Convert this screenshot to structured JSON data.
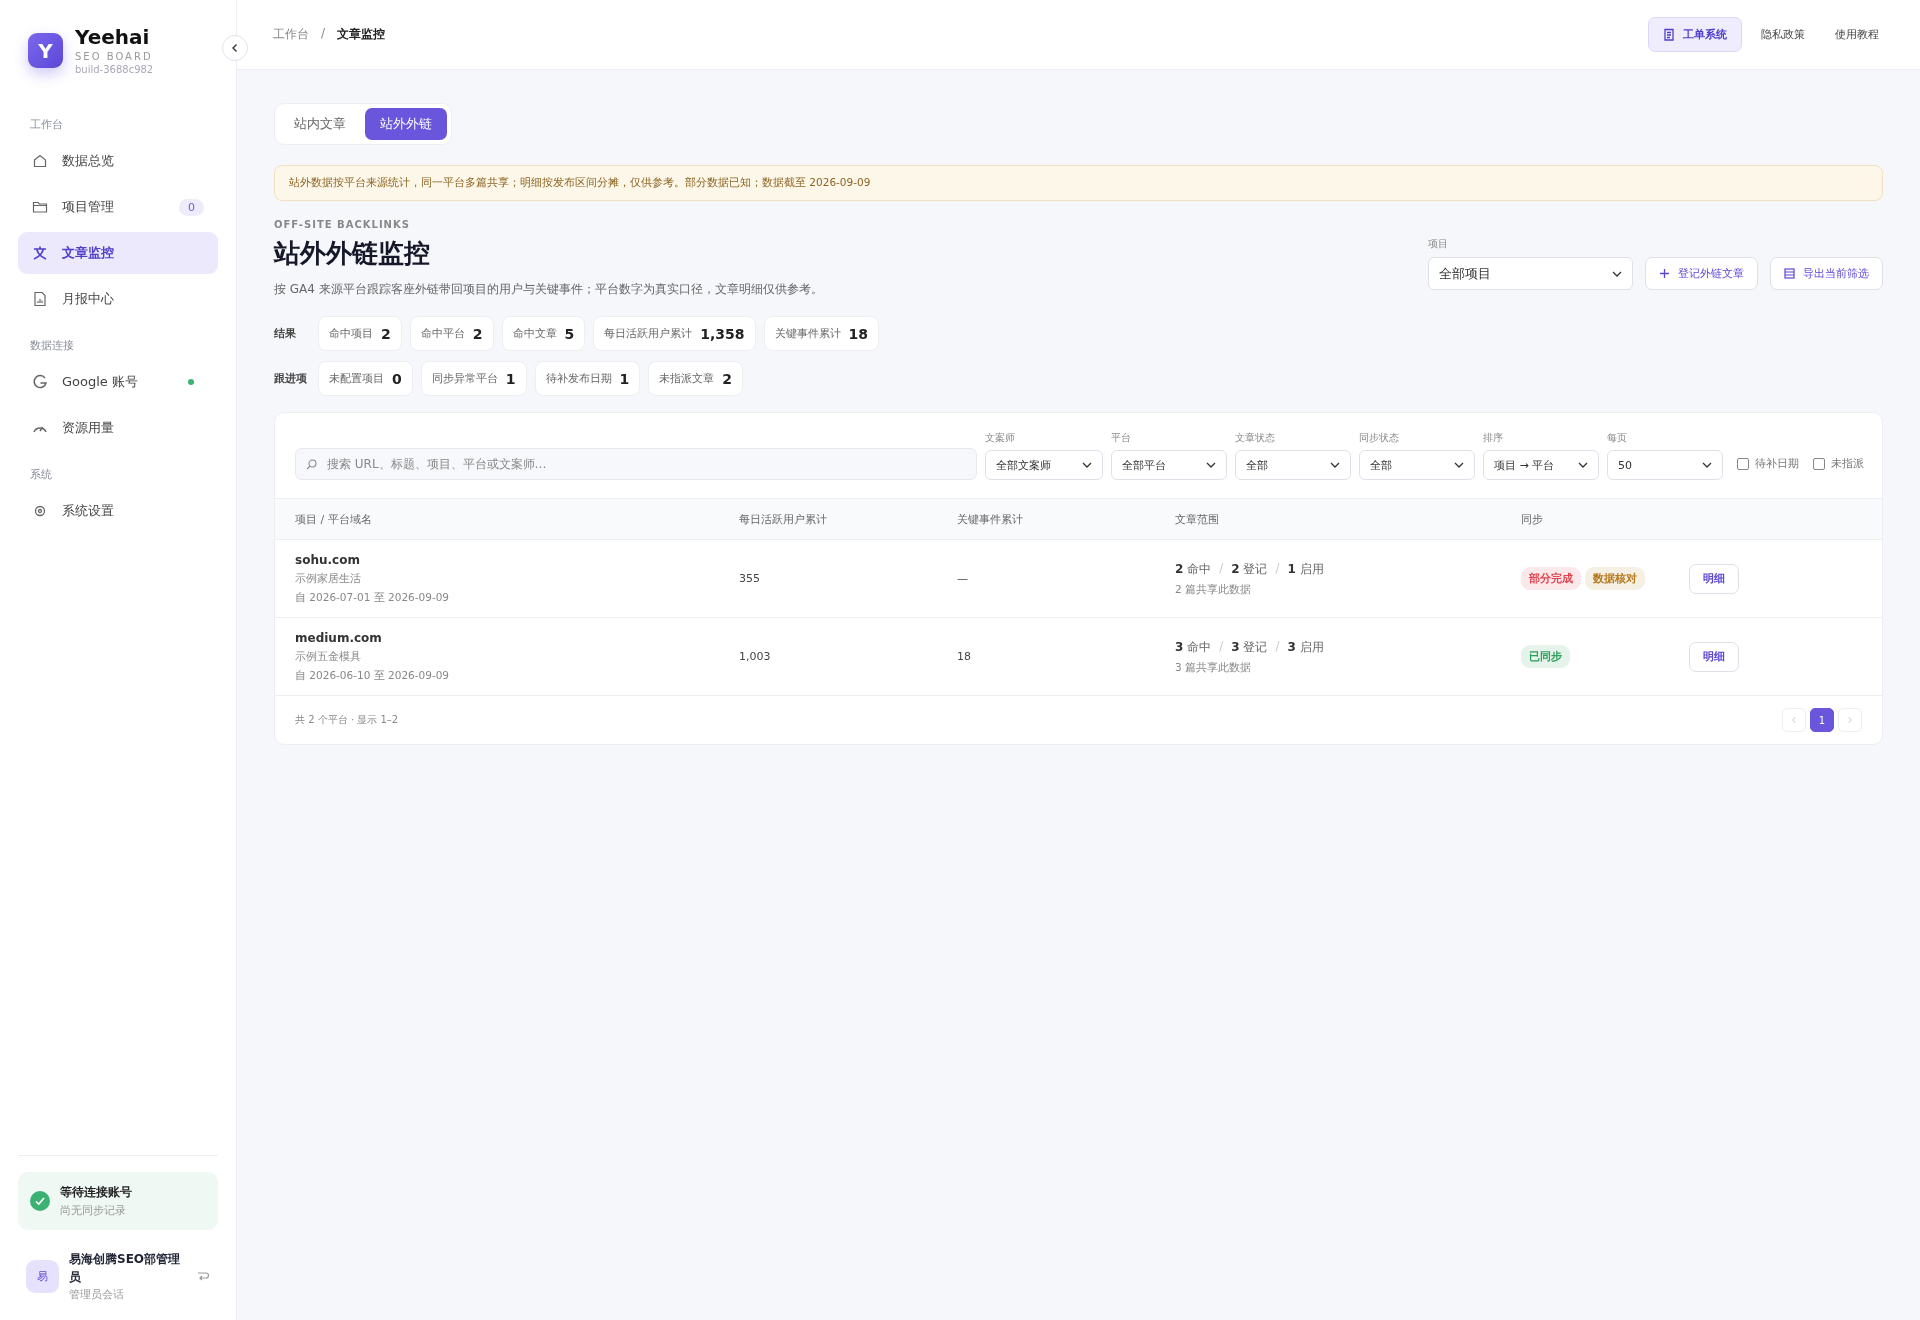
{
  "brand": {
    "logo": "Y",
    "name": "Yeehai",
    "subtitle": "SEO BOARD",
    "build": "build-3688c982"
  },
  "sidebar": {
    "sections": [
      {
        "title": "工作台",
        "items": [
          {
            "label": "数据总览",
            "selected": false
          },
          {
            "label": "项目管理",
            "selected": false,
            "badge": "0"
          },
          {
            "label": "文章监控",
            "selected": true
          },
          {
            "label": "月报中心",
            "selected": false
          }
        ]
      },
      {
        "title": "数据连接",
        "items": [
          {
            "label": "Google 账号",
            "selected": false,
            "connected": true
          },
          {
            "label": "资源用量",
            "selected": false
          }
        ]
      },
      {
        "title": "系统",
        "items": [
          {
            "label": "系统设置",
            "selected": false
          }
        ]
      }
    ],
    "status": {
      "title": "等待连接账号",
      "subtitle": "尚无同步记录"
    },
    "user": {
      "avatar": "易",
      "name": "易海创腾SEO部管理员",
      "role": "管理员会话"
    }
  },
  "header": {
    "breadcrumb": [
      "工作台",
      "文章监控"
    ],
    "separator": "/",
    "links": [
      {
        "label": "工单系统",
        "selected": true
      },
      {
        "label": "隐私政策",
        "selected": false
      },
      {
        "label": "使用教程",
        "selected": false
      }
    ]
  },
  "tabs": [
    {
      "label": "站内文章",
      "selected": false
    },
    {
      "label": "站外外链",
      "selected": true
    }
  ],
  "notice": "站外数据按平台来源统计，同一平台多篇共享；明细按发布区间分摊，仅供参考。部分数据已知；数据截至 2026-09-09",
  "page": {
    "eyebrow": "OFF-SITE BACKLINKS",
    "title": "站外外链监控",
    "description": "按 GA4 来源平台跟踪客座外链带回项目的用户与关键事件；平台数字为真实口径，文章明细仅供参考。",
    "project_filter": {
      "label": "项目",
      "value": "全部项目"
    },
    "actions": [
      "登记外链文章",
      "导出当前筛选"
    ]
  },
  "summary": [
    {
      "label": "结果",
      "chips": [
        {
          "label": "命中项目",
          "value": "2"
        },
        {
          "label": "命中平台",
          "value": "2"
        },
        {
          "label": "命中文章",
          "value": "5"
        },
        {
          "label": "每日活跃用户累计",
          "value": "1,358"
        },
        {
          "label": "关键事件累计",
          "value": "18"
        }
      ]
    },
    {
      "label": "跟进项",
      "chips": [
        {
          "label": "未配置项目",
          "value": "0"
        },
        {
          "label": "同步异常平台",
          "value": "1"
        },
        {
          "label": "待补发布日期",
          "value": "1"
        },
        {
          "label": "未指派文章",
          "value": "2"
        }
      ]
    }
  ],
  "filters": {
    "search": {
      "placeholder": "搜索 URL、标题、项目、平台或文案师…"
    },
    "selects": [
      {
        "label": "文案师",
        "value": "全部文案师"
      },
      {
        "label": "平台",
        "value": "全部平台"
      },
      {
        "label": "文章状态",
        "value": "全部"
      },
      {
        "label": "同步状态",
        "value": "全部"
      },
      {
        "label": "排序",
        "value": "项目 → 平台"
      },
      {
        "label": "每页",
        "value": "50"
      }
    ],
    "checkboxes": [
      {
        "label": "待补日期",
        "checked": false
      },
      {
        "label": "未指派",
        "checked": false
      }
    ]
  },
  "table": {
    "scope_separator": "/",
    "columns": [
      "项目 / 平台域名",
      "每日活跃用户累计",
      "关键事件累计",
      "文章范围",
      "同步"
    ],
    "rows": [
      {
        "domain": "sohu.com",
        "project": "示例家居生活",
        "range": "自 2026-07-01 至 2026-09-09",
        "users": "355",
        "events": "—",
        "hits": "2",
        "hits_label": "命中",
        "registered": "2",
        "registered_label": "登记",
        "enabled": "1",
        "enabled_label": "启用",
        "shared": "2 篇共享此数据",
        "sync": [
          {
            "label": "部分完成",
            "color": "#e0454f"
          },
          {
            "label": "数据核对",
            "color": "#b7791f"
          }
        ],
        "action": "明细"
      },
      {
        "domain": "medium.com",
        "project": "示例五金模具",
        "range": "自 2026-06-10 至 2026-09-09",
        "users": "1,003",
        "events": "18",
        "hits": "3",
        "hits_label": "命中",
        "registered": "3",
        "registered_label": "登记",
        "enabled": "3",
        "enabled_label": "启用",
        "shared": "3 篇共享此数据",
        "sync": [
          {
            "label": "已同步",
            "color": "#2f9e5b"
          }
        ],
        "action": "明细"
      }
    ],
    "footer": "共 2 个平台 · 显示 1–2",
    "pages": [
      {
        "label": "1",
        "selected": true
      }
    ]
  }
}
